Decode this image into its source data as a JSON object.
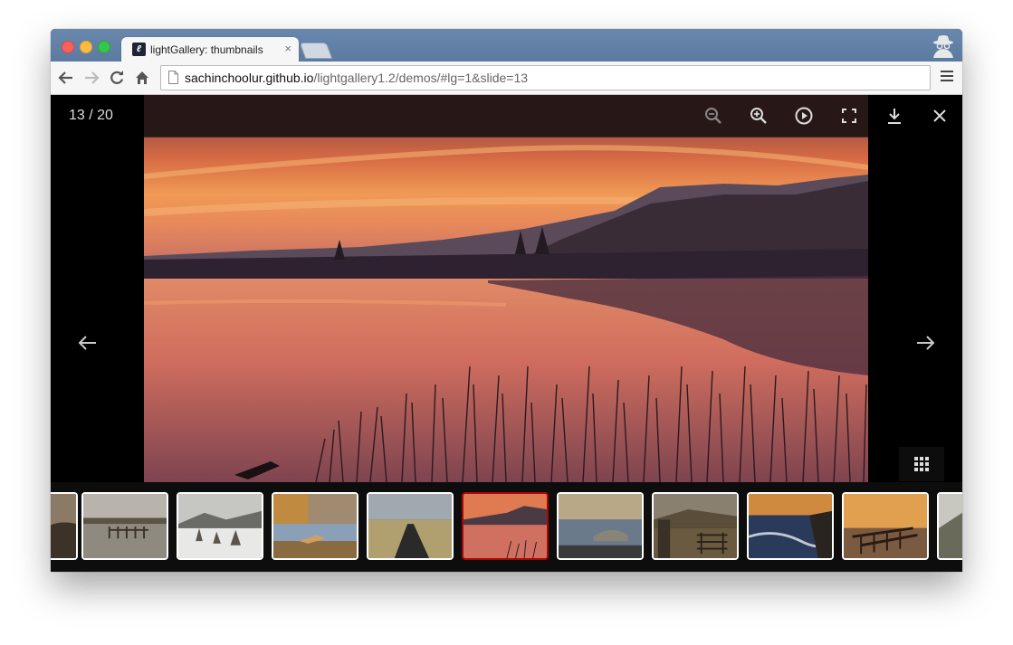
{
  "browser": {
    "tab_title": "lightGallery: thumbnails",
    "tab_close": "×",
    "favicon_letter": "lg",
    "url_host": "sachinchoolur.github.io",
    "url_path": "/lightgallery1.2/demos/#lg=1&slide=13",
    "nav_icons": [
      "back-arrow-icon",
      "forward-arrow-icon",
      "reload-icon",
      "home-icon"
    ]
  },
  "gallery": {
    "counter": "13 / 20",
    "current_slide": 13,
    "total_slides": 20,
    "toolbar_icons": [
      "zoom-out-icon",
      "zoom-in-icon",
      "autoplay-icon",
      "fullscreen-icon",
      "download-icon",
      "close-icon"
    ],
    "accent_color": "#a90707",
    "thumbnails": [
      {
        "name": "rocky-shore",
        "active": false
      },
      {
        "name": "flooded-fence",
        "active": false
      },
      {
        "name": "snowy-stones",
        "active": false
      },
      {
        "name": "autumn-lake",
        "active": false
      },
      {
        "name": "country-road",
        "active": false
      },
      {
        "name": "sunset-lake",
        "active": true
      },
      {
        "name": "lake-rocks",
        "active": false
      },
      {
        "name": "stone-wall-gate",
        "active": false
      },
      {
        "name": "coast-waves",
        "active": false
      },
      {
        "name": "wooden-pier",
        "active": false
      },
      {
        "name": "mountain-edge",
        "active": false
      }
    ]
  }
}
